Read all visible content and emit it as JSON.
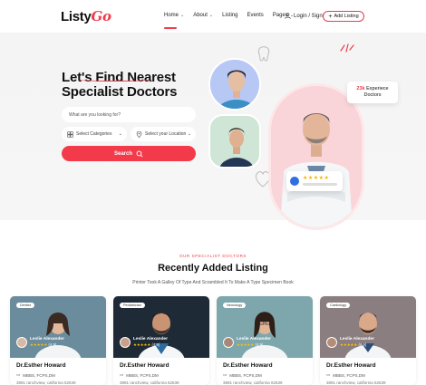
{
  "header": {
    "logo_text": "Listy",
    "logo_accent": "Go",
    "nav": [
      {
        "label": "Home",
        "chevron": true
      },
      {
        "label": "About",
        "chevron": true
      },
      {
        "label": "Listing",
        "chevron": false
      },
      {
        "label": "Events",
        "chevron": false
      },
      {
        "label": "Pages",
        "chevron": true
      }
    ],
    "login_label": "Login / Signup",
    "add_listing_label": "Add Listing"
  },
  "hero": {
    "title_line1": "Let's Find Nearest",
    "title_line2": "Specialist Doctors",
    "search_placeholder": "What are you looking for?",
    "category_select": "Select Categories",
    "location_select": "Select your Location",
    "search_button": "Search",
    "experience_number": "23k",
    "experience_text_1": "Experiece",
    "experience_text_2": "Doctors",
    "rating_stars": "★★★★★"
  },
  "section": {
    "subtitle": "OUR SPECIALIST DOCTORS",
    "title": "Recently Added Listing",
    "description": "Printer Took A Galley Of Type And Scrambled It To Make A Type Specimen Book"
  },
  "cards": [
    {
      "tag": "Dentist",
      "author": "Leslie Alexander",
      "stars": "★★★★★",
      "rating": "(4.9)",
      "name": "Dr.Esther Howard",
      "degree": "MBBS, FCPS,DM",
      "address": "3891 ranchview, california 62639",
      "bg": "#6c8a9b"
    },
    {
      "tag": "Pediatrician",
      "author": "Leslie Alexander",
      "stars": "★★★★★",
      "rating": "(4.9)",
      "name": "Dr.Esther Howard",
      "degree": "MBBS, FCPS,DM",
      "address": "3891 ranchview, california 62639",
      "bg": "#1f2e3a"
    },
    {
      "tag": "Neurology",
      "author": "Leslie Alexander",
      "stars": "★★★★★",
      "rating": "(4.9)",
      "name": "Dr.Esther Howard",
      "degree": "MBBS, FCPS,DM",
      "address": "3891 ranchview, california 62639",
      "bg": "#7fa7ad"
    },
    {
      "tag": "Cardiology",
      "author": "Leslie Alexander",
      "stars": "★★★★★",
      "rating": "(4.9)",
      "name": "Dr.Esther Howard",
      "degree": "MBBS, FCPS,DM",
      "address": "3891 ranchview, california 62639",
      "bg": "#8b7d7f"
    }
  ],
  "colors": {
    "accent": "#ef3b4b",
    "star": "#f6b400"
  }
}
